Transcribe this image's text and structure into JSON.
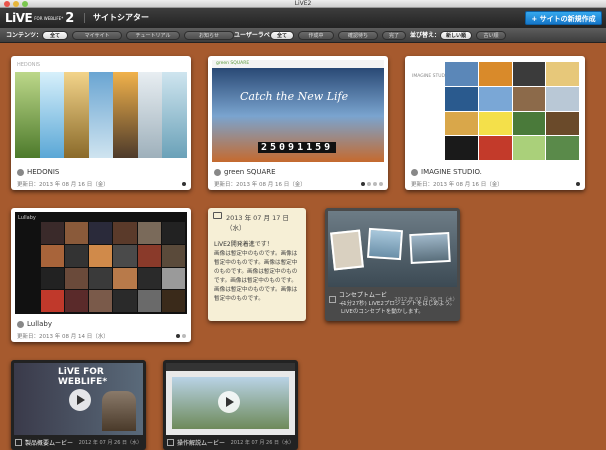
{
  "window": {
    "title": "LiVE2"
  },
  "app": {
    "logo_main": "LiVE",
    "logo_sub": "FOR WEBLIFE*",
    "logo_version": "2",
    "section_title": "サイトシアター",
    "new_site_button": "サイトの新規作成"
  },
  "filters": {
    "content_label": "コンテンツ：",
    "content_chips": [
      "全て",
      "マイサイト",
      "チュートリアル",
      "お知らせ"
    ],
    "user_label_label": "ユーザーラベル：",
    "user_label_chips": [
      "全て",
      "作成中",
      "確認待ち",
      "完了"
    ],
    "sort_label": "並び替え：",
    "sort_chips": [
      "新しい順",
      "古い順"
    ]
  },
  "cards": [
    {
      "name": "HEDONIS",
      "date": "更新日：2013 年 08 月 16 日（金）",
      "header": "HEDONIS"
    },
    {
      "name": "green SQUARE",
      "date": "更新日：2013 年 08 月 16 日（金）",
      "header": "green SQUARE",
      "headline": "Catch the New Life",
      "counter": "25091159"
    },
    {
      "name": "IMAGINE STUDIO.",
      "date": "更新日：2013 年 08 月 16 日（金）",
      "header": "IMAGINE STUDIO."
    },
    {
      "name": "Lullaby",
      "date": "更新日：2013 年 08 月 14 日（水）",
      "header": "Lullaby"
    }
  ],
  "note": {
    "date": "2013 年 07 月 17 日（水）",
    "title": "LiVE2開発着進です！",
    "body": "画像は暫定中のものです。画像は暫定中のものです。画像は暫定中のものです。画像は暫定中のものです。画像は暫定中のものです。画像は暫定中のものです。画像は暫定中のものです。"
  },
  "concept_video": {
    "title": "コンセプトムービー",
    "date": "2012 年 07 月 26 日（水）",
    "description": "(1分27秒) LiVE2プロジェクトをはじめよう。LiVEのコンセプトを動かします。"
  },
  "videos": [
    {
      "title": "製品概要ムービー",
      "date": "2012 年 07 月 26 日（水）",
      "banner": "LiVE FOR WEBLIFE*"
    },
    {
      "title": "操作解説ムービー",
      "date": "2012 年 07 月 26 日（水）"
    }
  ],
  "colors": {
    "accent": "#1f8ee0",
    "wood": "#a65a2e"
  }
}
